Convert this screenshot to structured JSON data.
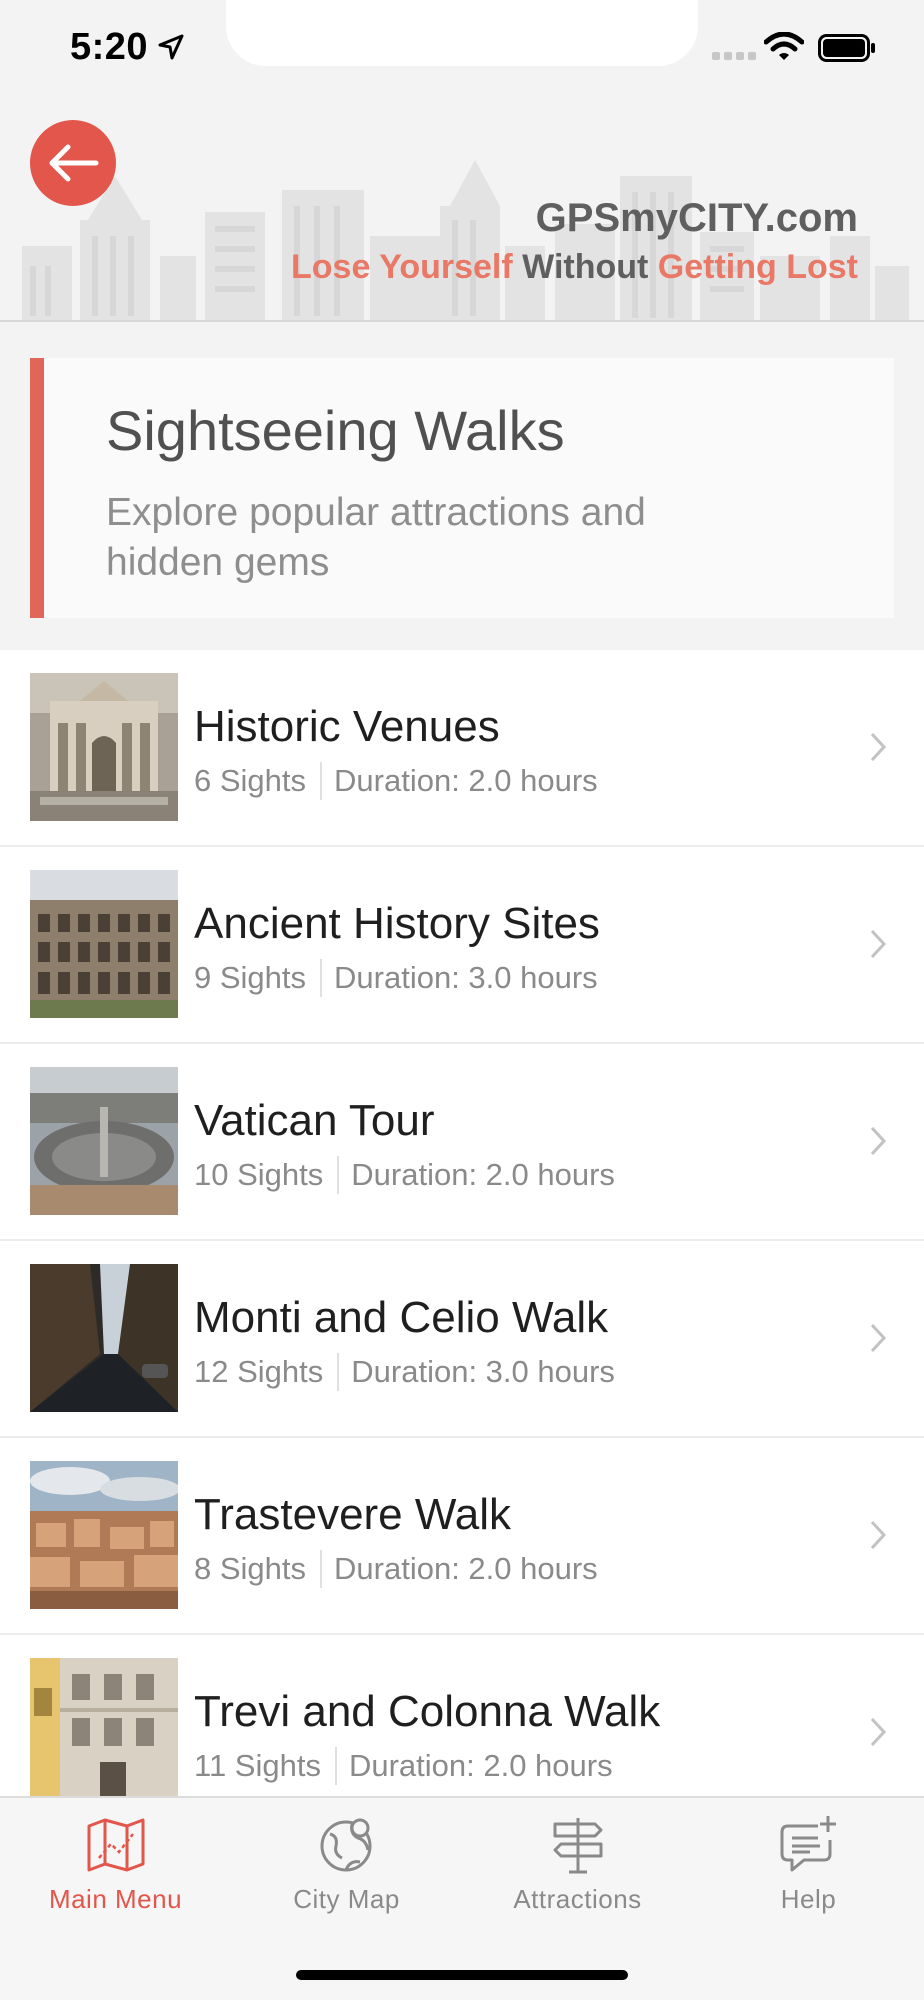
{
  "status_bar": {
    "time": "5:20"
  },
  "header": {
    "brand": "GPSmyCITY.com",
    "tagline_part1": "Lose Yourself",
    "tagline_part2": " Without ",
    "tagline_part3": "Getting Lost",
    "accent_color": "#e2564b"
  },
  "section": {
    "title": "Sightseeing Walks",
    "subtitle": "Explore popular attractions and hidden gems"
  },
  "walks": [
    {
      "title": "Historic Venues",
      "sights": "6 Sights",
      "duration": "Duration: 2.0 hours"
    },
    {
      "title": "Ancient History Sites",
      "sights": "9 Sights",
      "duration": "Duration: 3.0 hours"
    },
    {
      "title": "Vatican Tour",
      "sights": "10 Sights",
      "duration": "Duration: 2.0 hours"
    },
    {
      "title": "Monti and Celio Walk",
      "sights": "12 Sights",
      "duration": "Duration: 3.0 hours"
    },
    {
      "title": "Trastevere Walk",
      "sights": "8 Sights",
      "duration": "Duration: 2.0 hours"
    },
    {
      "title": "Trevi and Colonna Walk",
      "sights": "11 Sights",
      "duration": "Duration: 2.0 hours"
    }
  ],
  "tabs": [
    {
      "label": "Main Menu",
      "icon": "map-icon",
      "active": true
    },
    {
      "label": "City Map",
      "icon": "globe-icon",
      "active": false
    },
    {
      "label": "Attractions",
      "icon": "signpost-icon",
      "active": false
    },
    {
      "label": "Help",
      "icon": "chat-plus-icon",
      "active": false
    }
  ]
}
